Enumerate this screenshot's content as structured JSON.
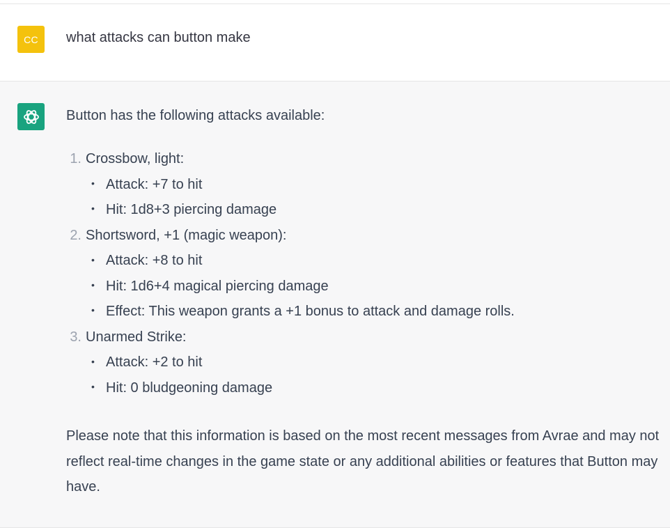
{
  "user_message": {
    "avatar_initials": "CC",
    "avatar_color": "#f4c20d",
    "text": "what attacks can button make"
  },
  "assistant_message": {
    "avatar_icon": "openai-logo-icon",
    "avatar_color": "#19a37f",
    "intro": "Button has the following attacks available:",
    "attacks": [
      {
        "number": "1.",
        "name": "Crossbow, light:",
        "details": [
          "Attack: +7 to hit",
          "Hit: 1d8+3 piercing damage"
        ]
      },
      {
        "number": "2.",
        "name": "Shortsword, +1 (magic weapon):",
        "details": [
          "Attack: +8 to hit",
          "Hit: 1d6+4 magical piercing damage",
          "Effect: This weapon grants a +1 bonus to attack and damage rolls."
        ]
      },
      {
        "number": "3.",
        "name": "Unarmed Strike:",
        "details": [
          "Attack: +2 to hit",
          "Hit: 0 bludgeoning damage"
        ]
      }
    ],
    "note": "Please note that this information is based on the most recent messages from Avrae and may not reflect real-time changes in the game state or any additional abilities or features that Button may have."
  }
}
